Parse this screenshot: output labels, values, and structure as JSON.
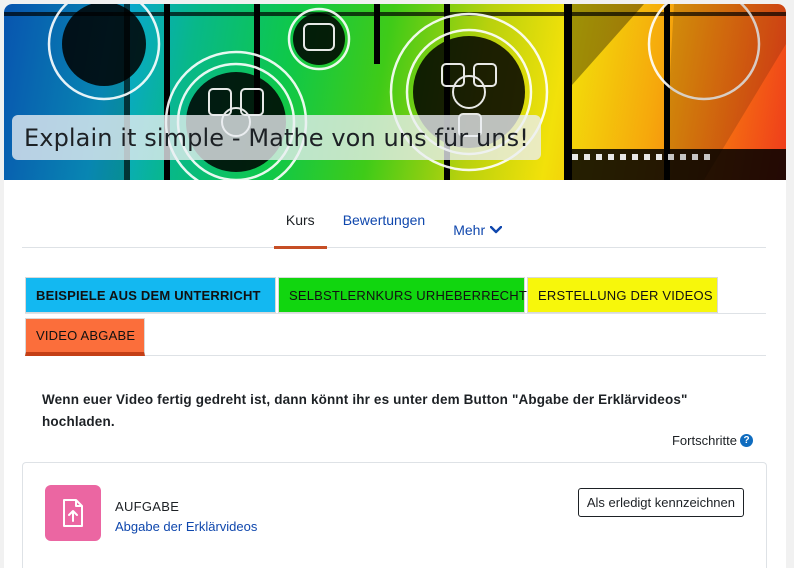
{
  "banner": {
    "title": "Explain it simple - Mathe von uns für uns!"
  },
  "nav": {
    "items": [
      {
        "label": "Kurs",
        "active": true
      },
      {
        "label": "Bewertungen",
        "active": false
      },
      {
        "label": "Mehr",
        "active": false
      }
    ]
  },
  "sections": {
    "tiles": [
      {
        "label": "BEISPIELE AUS DEM UNTERRICHT",
        "color": "#13b8f1"
      },
      {
        "label": "SELBSTLERNKURS URHEBERRECHT",
        "color": "#11d60f"
      },
      {
        "label": "ERSTELLUNG DER VIDEOS",
        "color": "#f7f70b"
      },
      {
        "label": "VIDEO ABGABE",
        "color": "#fb6e3b",
        "active": true
      }
    ]
  },
  "content": {
    "description": "Wenn euer Video fertig gedreht ist, dann könnt ihr es unter dem Button \"Abgabe der Erklärvideos\" hochladen.",
    "progress_label": "Fortschritte",
    "help_icon": "question-circle-icon"
  },
  "activity": {
    "type_label": "AUFGABE",
    "name": "Abgabe der Erklärvideos",
    "icon": "file-upload-icon",
    "icon_color": "#eb66a2",
    "completion_button": "Als erledigt kennzeichnen"
  },
  "colors": {
    "link": "#0f47ad",
    "active_underline": "#c64e25"
  }
}
